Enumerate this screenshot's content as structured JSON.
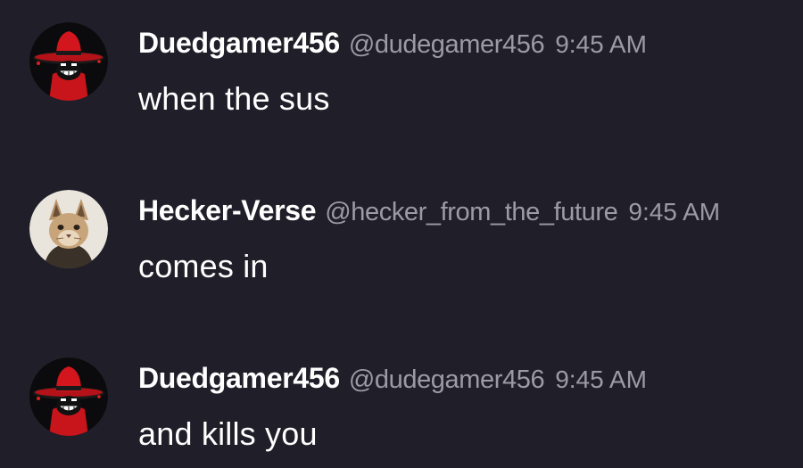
{
  "messages": [
    {
      "username": "Duedgamer456",
      "handle": "@dudegamer456",
      "time": "9:45 AM",
      "text": "when the sus",
      "avatar": "red-hat-grin-avatar"
    },
    {
      "username": "Hecker-Verse",
      "handle": "@hecker_from_the_future",
      "time": "9:45 AM",
      "text": "comes in",
      "avatar": "caracal-cat-avatar"
    },
    {
      "username": "Duedgamer456",
      "handle": "@dudegamer456",
      "time": "9:45 AM",
      "text": "and kills you",
      "avatar": "red-hat-grin-avatar"
    }
  ],
  "colors": {
    "background": "#201f29",
    "username": "#ffffff",
    "meta": "#9c9aa6",
    "text": "#ffffff"
  }
}
